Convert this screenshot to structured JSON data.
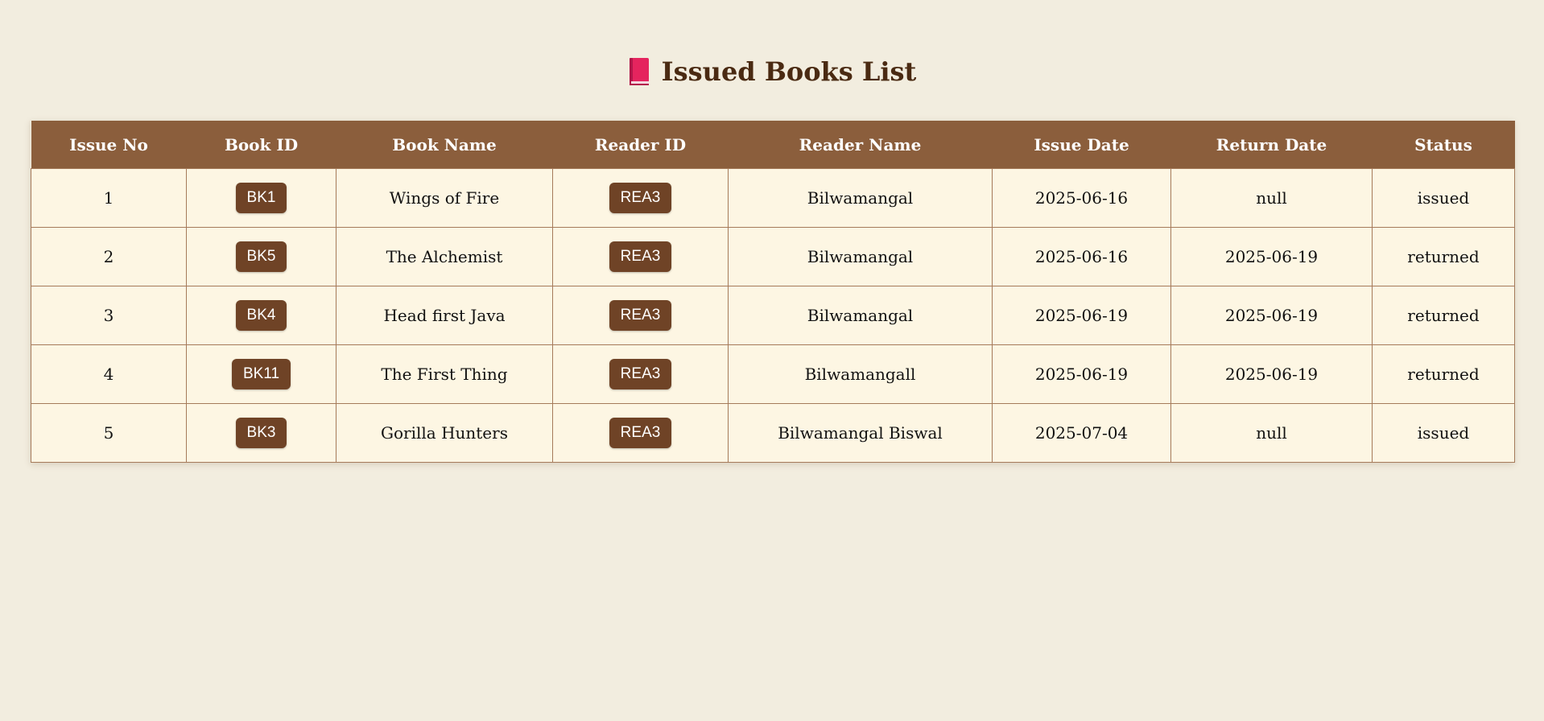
{
  "page": {
    "title": "Issued Books List",
    "title_icon": "closed-book-icon"
  },
  "colors": {
    "background": "#f2eddf",
    "header_bg": "#8b5e3c",
    "row_bg": "#fdf6e3",
    "badge_bg": "#6f4326",
    "title_color": "#4a2a12",
    "border": "#a57a5a"
  },
  "table": {
    "columns": [
      "Issue No",
      "Book ID",
      "Book Name",
      "Reader ID",
      "Reader Name",
      "Issue Date",
      "Return Date",
      "Status"
    ],
    "rows": [
      {
        "issue_no": "1",
        "book_id": "BK1",
        "book_name": "Wings of Fire",
        "reader_id": "REA3",
        "reader_name": "Bilwamangal",
        "issue_date": "2025-06-16",
        "return_date": "null",
        "status": "issued"
      },
      {
        "issue_no": "2",
        "book_id": "BK5",
        "book_name": "The Alchemist",
        "reader_id": "REA3",
        "reader_name": "Bilwamangal",
        "issue_date": "2025-06-16",
        "return_date": "2025-06-19",
        "status": "returned"
      },
      {
        "issue_no": "3",
        "book_id": "BK4",
        "book_name": "Head first Java",
        "reader_id": "REA3",
        "reader_name": "Bilwamangal",
        "issue_date": "2025-06-19",
        "return_date": "2025-06-19",
        "status": "returned"
      },
      {
        "issue_no": "4",
        "book_id": "BK11",
        "book_name": "The First Thing",
        "reader_id": "REA3",
        "reader_name": "Bilwamangall",
        "issue_date": "2025-06-19",
        "return_date": "2025-06-19",
        "status": "returned"
      },
      {
        "issue_no": "5",
        "book_id": "BK3",
        "book_name": "Gorilla Hunters",
        "reader_id": "REA3",
        "reader_name": "Bilwamangal Biswal",
        "issue_date": "2025-07-04",
        "return_date": "null",
        "status": "issued"
      }
    ]
  }
}
